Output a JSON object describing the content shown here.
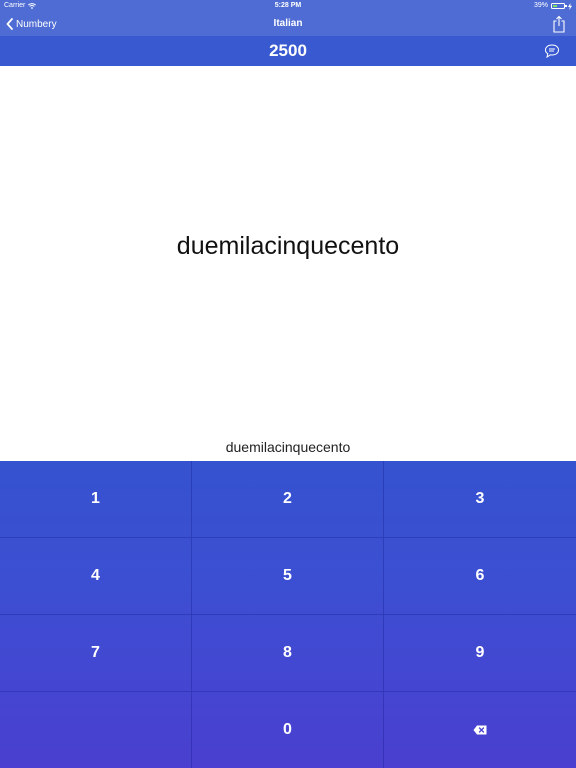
{
  "status_bar": {
    "carrier": "Carrier",
    "time": "5:28 PM",
    "battery": "39%",
    "battery_level": 0.39
  },
  "nav": {
    "back_label": "Numbery",
    "title": "Italian",
    "icons": {
      "back": "chevron-left-icon",
      "share": "share-icon"
    }
  },
  "number_bar": {
    "number": "2500",
    "icons": {
      "speech": "speech-bubble-icon"
    }
  },
  "main": {
    "word": "duemilacinquecento",
    "answer": "duemilacinquecento"
  },
  "keypad": {
    "keys": [
      "1",
      "2",
      "3",
      "4",
      "5",
      "6",
      "7",
      "8",
      "9",
      "",
      "0",
      "⌫"
    ],
    "delete_icon": "backspace-icon"
  },
  "colors": {
    "nav_background": "#4e6cd3",
    "number_bar_background": "#3959d1",
    "keypad_top": "#3552cf",
    "keypad_bottom": "#4a3fd0",
    "battery_fill": "#7be36b"
  }
}
